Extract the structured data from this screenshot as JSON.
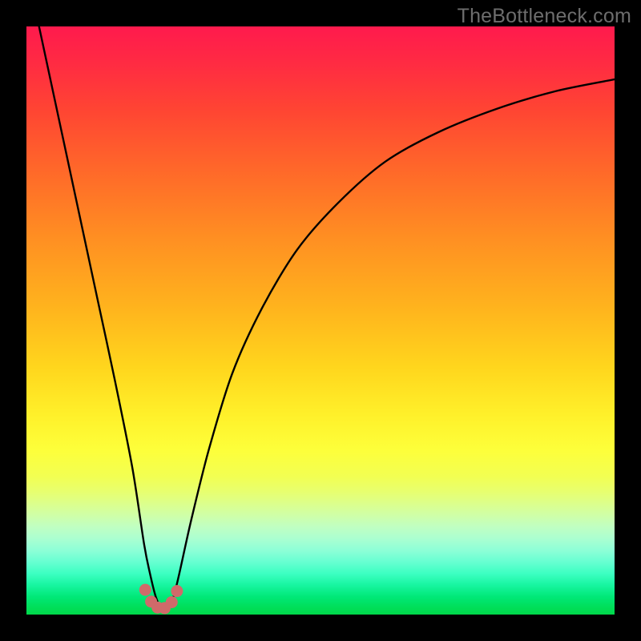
{
  "watermark": "TheBottleneck.com",
  "chart_data": {
    "type": "line",
    "title": "",
    "xlabel": "",
    "ylabel": "",
    "xlim": [
      0,
      100
    ],
    "ylim": [
      0,
      100
    ],
    "x_optimum_pct": 23,
    "series": [
      {
        "name": "bottleneck-curve",
        "x": [
          0,
          3,
          6,
          9,
          12,
          15,
          18,
          20,
          21,
          22,
          23,
          24,
          25,
          26,
          28,
          31,
          35,
          40,
          46,
          53,
          61,
          70,
          80,
          90,
          100
        ],
        "values": [
          110,
          96,
          82,
          68,
          54,
          40,
          25,
          12,
          7,
          3,
          1,
          1,
          3,
          7,
          16,
          28,
          41,
          52,
          62,
          70,
          77,
          82,
          86,
          89,
          91
        ]
      }
    ],
    "markers": {
      "name": "bottom-cluster",
      "x": [
        20.2,
        21.2,
        22.3,
        23.5,
        24.7,
        25.6
      ],
      "values": [
        4.2,
        2.2,
        1.2,
        1.1,
        2.1,
        4.0
      ]
    },
    "colors": {
      "curve": "#000000",
      "marker": "#d06a6a",
      "gradient_top": "#ff1a4d",
      "gradient_bottom": "#00d94a"
    }
  }
}
